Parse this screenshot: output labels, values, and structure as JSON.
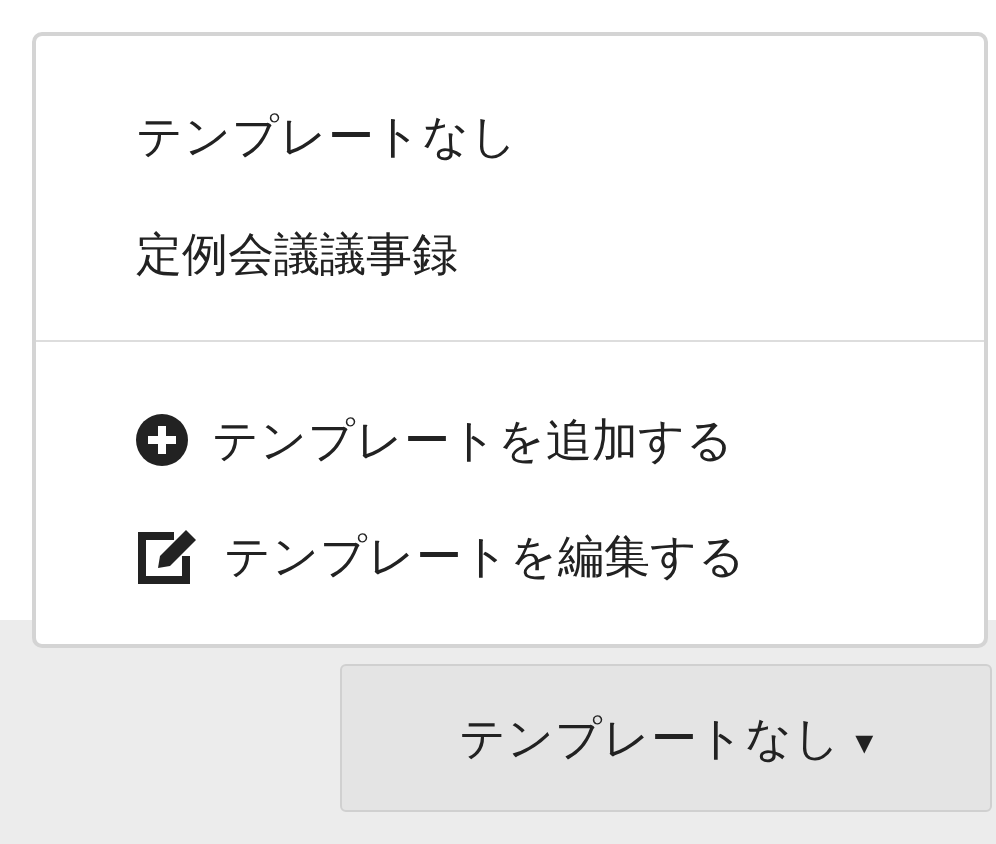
{
  "template_menu": {
    "expanded": true,
    "options": [
      {
        "label": "テンプレートなし",
        "selected": false
      },
      {
        "label": "定例会議議事録",
        "selected": false
      }
    ],
    "actions": [
      {
        "kind": "add",
        "label": "テンプレートを追加する"
      },
      {
        "kind": "edit",
        "label": "テンプレートを編集する"
      }
    ]
  },
  "template_button": {
    "label": "テンプレートなし",
    "caret": "▾"
  }
}
